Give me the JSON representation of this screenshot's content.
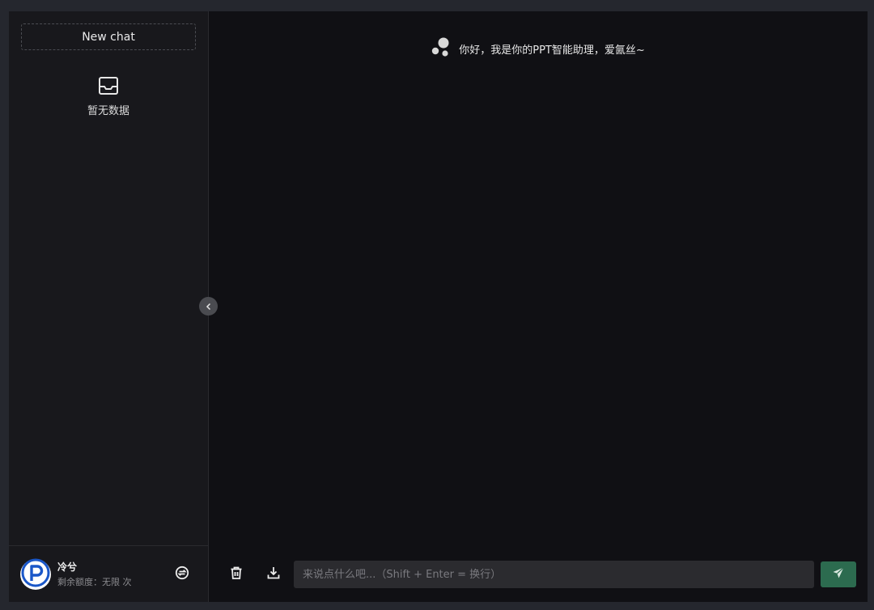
{
  "sidebar": {
    "new_chat_label": "New chat",
    "empty_text": "暂无数据",
    "user": {
      "name": "冷兮",
      "quota": "剩余额度：无限 次"
    }
  },
  "main": {
    "greeting": "你好，我是你的PPT智能助理，爱氤丝~",
    "input_placeholder": "来说点什么吧...（Shift + Enter = 换行）"
  },
  "icons": {
    "empty": "inbox-icon",
    "avatar": "p-logo-icon",
    "settings": "settings-icon",
    "collapse": "chevron-left-icon",
    "assistant": "assistant-dots-icon",
    "clear": "trash-icon",
    "export": "download-icon",
    "send": "send-icon"
  },
  "colors": {
    "accent": "#2c6b4f",
    "avatar_brand": "#1a57c8"
  }
}
